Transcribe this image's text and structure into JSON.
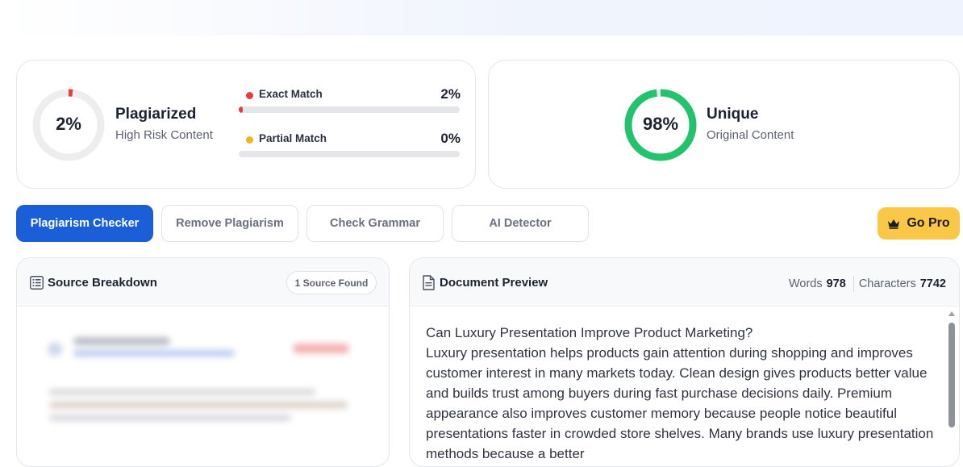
{
  "plagiarism": {
    "percent_label": "2%",
    "percent_value": 2,
    "title": "Plagiarized",
    "subtitle": "High Risk Content",
    "ring_color": "#e53e3e",
    "matches": [
      {
        "label": "Exact Match",
        "percent_label": "2%",
        "percent_value": 2,
        "color": "#e53e3e"
      },
      {
        "label": "Partial Match",
        "percent_label": "0%",
        "percent_value": 0,
        "color": "#f6b21b"
      }
    ]
  },
  "unique": {
    "percent_label": "98%",
    "percent_value": 98,
    "title": "Unique",
    "subtitle": "Original Content",
    "ring_color": "#22c36b"
  },
  "tabs": [
    {
      "label": "Plagiarism Checker",
      "active": true
    },
    {
      "label": "Remove Plagiarism",
      "active": false
    },
    {
      "label": "Check Grammar",
      "active": false
    },
    {
      "label": "AI Detector",
      "active": false
    }
  ],
  "go_pro": {
    "label": "Go Pro",
    "icon": "crown-icon"
  },
  "source_panel": {
    "title": "Source Breakdown",
    "icon": "list-icon",
    "badge": "1 Source Found"
  },
  "document_panel": {
    "title": "Document Preview",
    "icon": "document-icon",
    "words_label": "Words",
    "words_value": "978",
    "characters_label": "Characters",
    "characters_value": "7742",
    "heading_line": "Can Luxury Presentation Improve Product Marketing?",
    "body_text": "Luxury presentation helps products gain attention during shopping and improves customer interest in many markets today. Clean design gives products better value and builds trust among buyers during fast purchase decisions daily. Premium appearance also improves customer memory because people notice beautiful presentations faster in crowded store shelves. Many brands use luxury presentation methods because a better"
  }
}
